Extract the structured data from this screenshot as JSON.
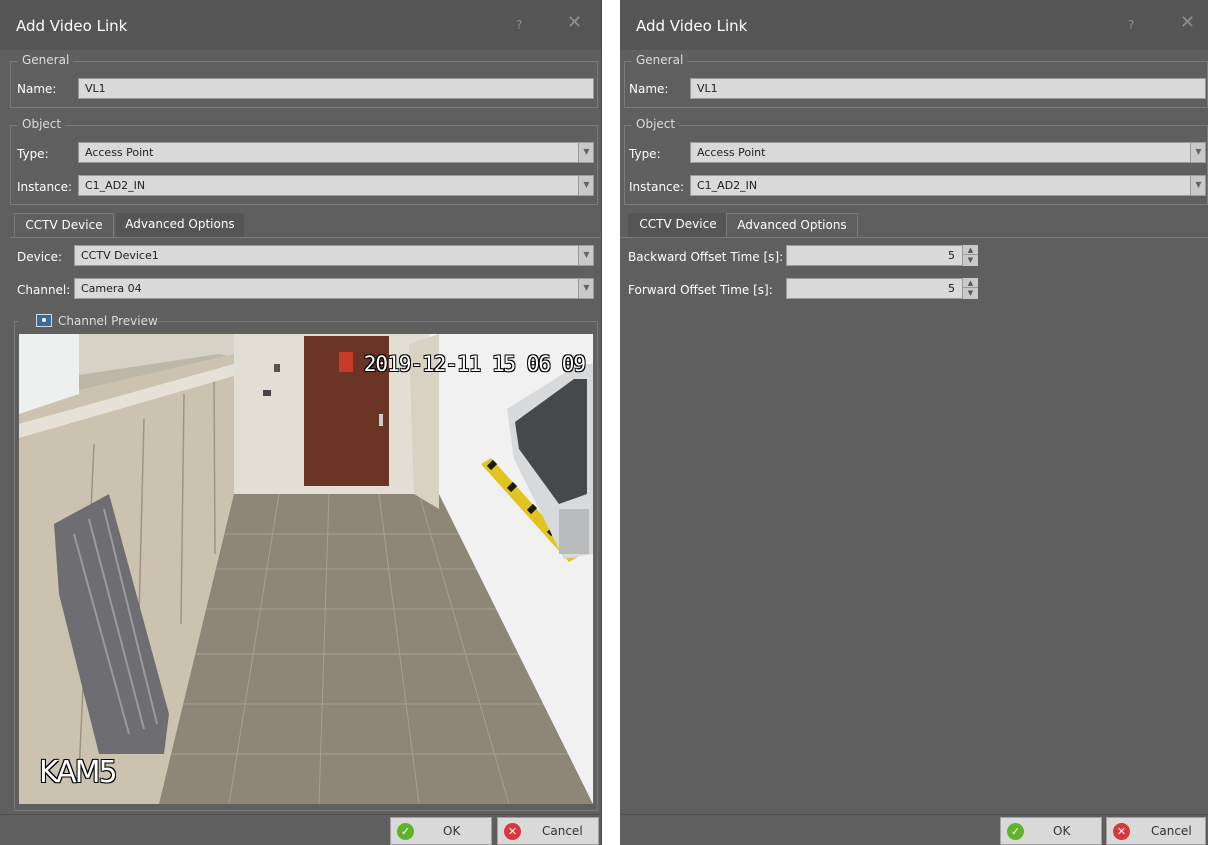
{
  "dialog_title": "Add Video Link",
  "help_glyph": "?",
  "close_glyph": "✕",
  "general": {
    "title": "General",
    "name_label": "Name:",
    "name_value": "VL1"
  },
  "object": {
    "title": "Object",
    "type_label": "Type:",
    "type_value": "Access Point",
    "instance_label": "Instance:",
    "instance_value": "C1_AD2_IN"
  },
  "tabs": {
    "cctv": "CCTV Device",
    "advanced": "Advanced Options"
  },
  "cctv": {
    "device_label": "Device:",
    "device_value": "CCTV Device1",
    "channel_label": "Channel:",
    "channel_value": "Camera 04",
    "preview_title": "Channel Preview",
    "osd_timestamp": "2019-12-11 15 06 09",
    "osd_camera": "KAM5"
  },
  "advanced": {
    "backward_label": "Backward Offset Time [s]:",
    "backward_value": "5",
    "forward_label": "Forward Offset Time [s]:",
    "forward_value": "5"
  },
  "buttons": {
    "ok": "OK",
    "cancel": "Cancel"
  },
  "icons": {
    "dropdown": "▼",
    "spin_up": "▲",
    "spin_down": "▼",
    "ok": "✓",
    "cancel": "✕"
  },
  "colors": {
    "dialog_bg": "#5f5f5f",
    "titlebar_bg": "#555555",
    "field_bg": "#d9d9d9",
    "ok_green": "#5fb42c",
    "cancel_red": "#d9383a"
  }
}
